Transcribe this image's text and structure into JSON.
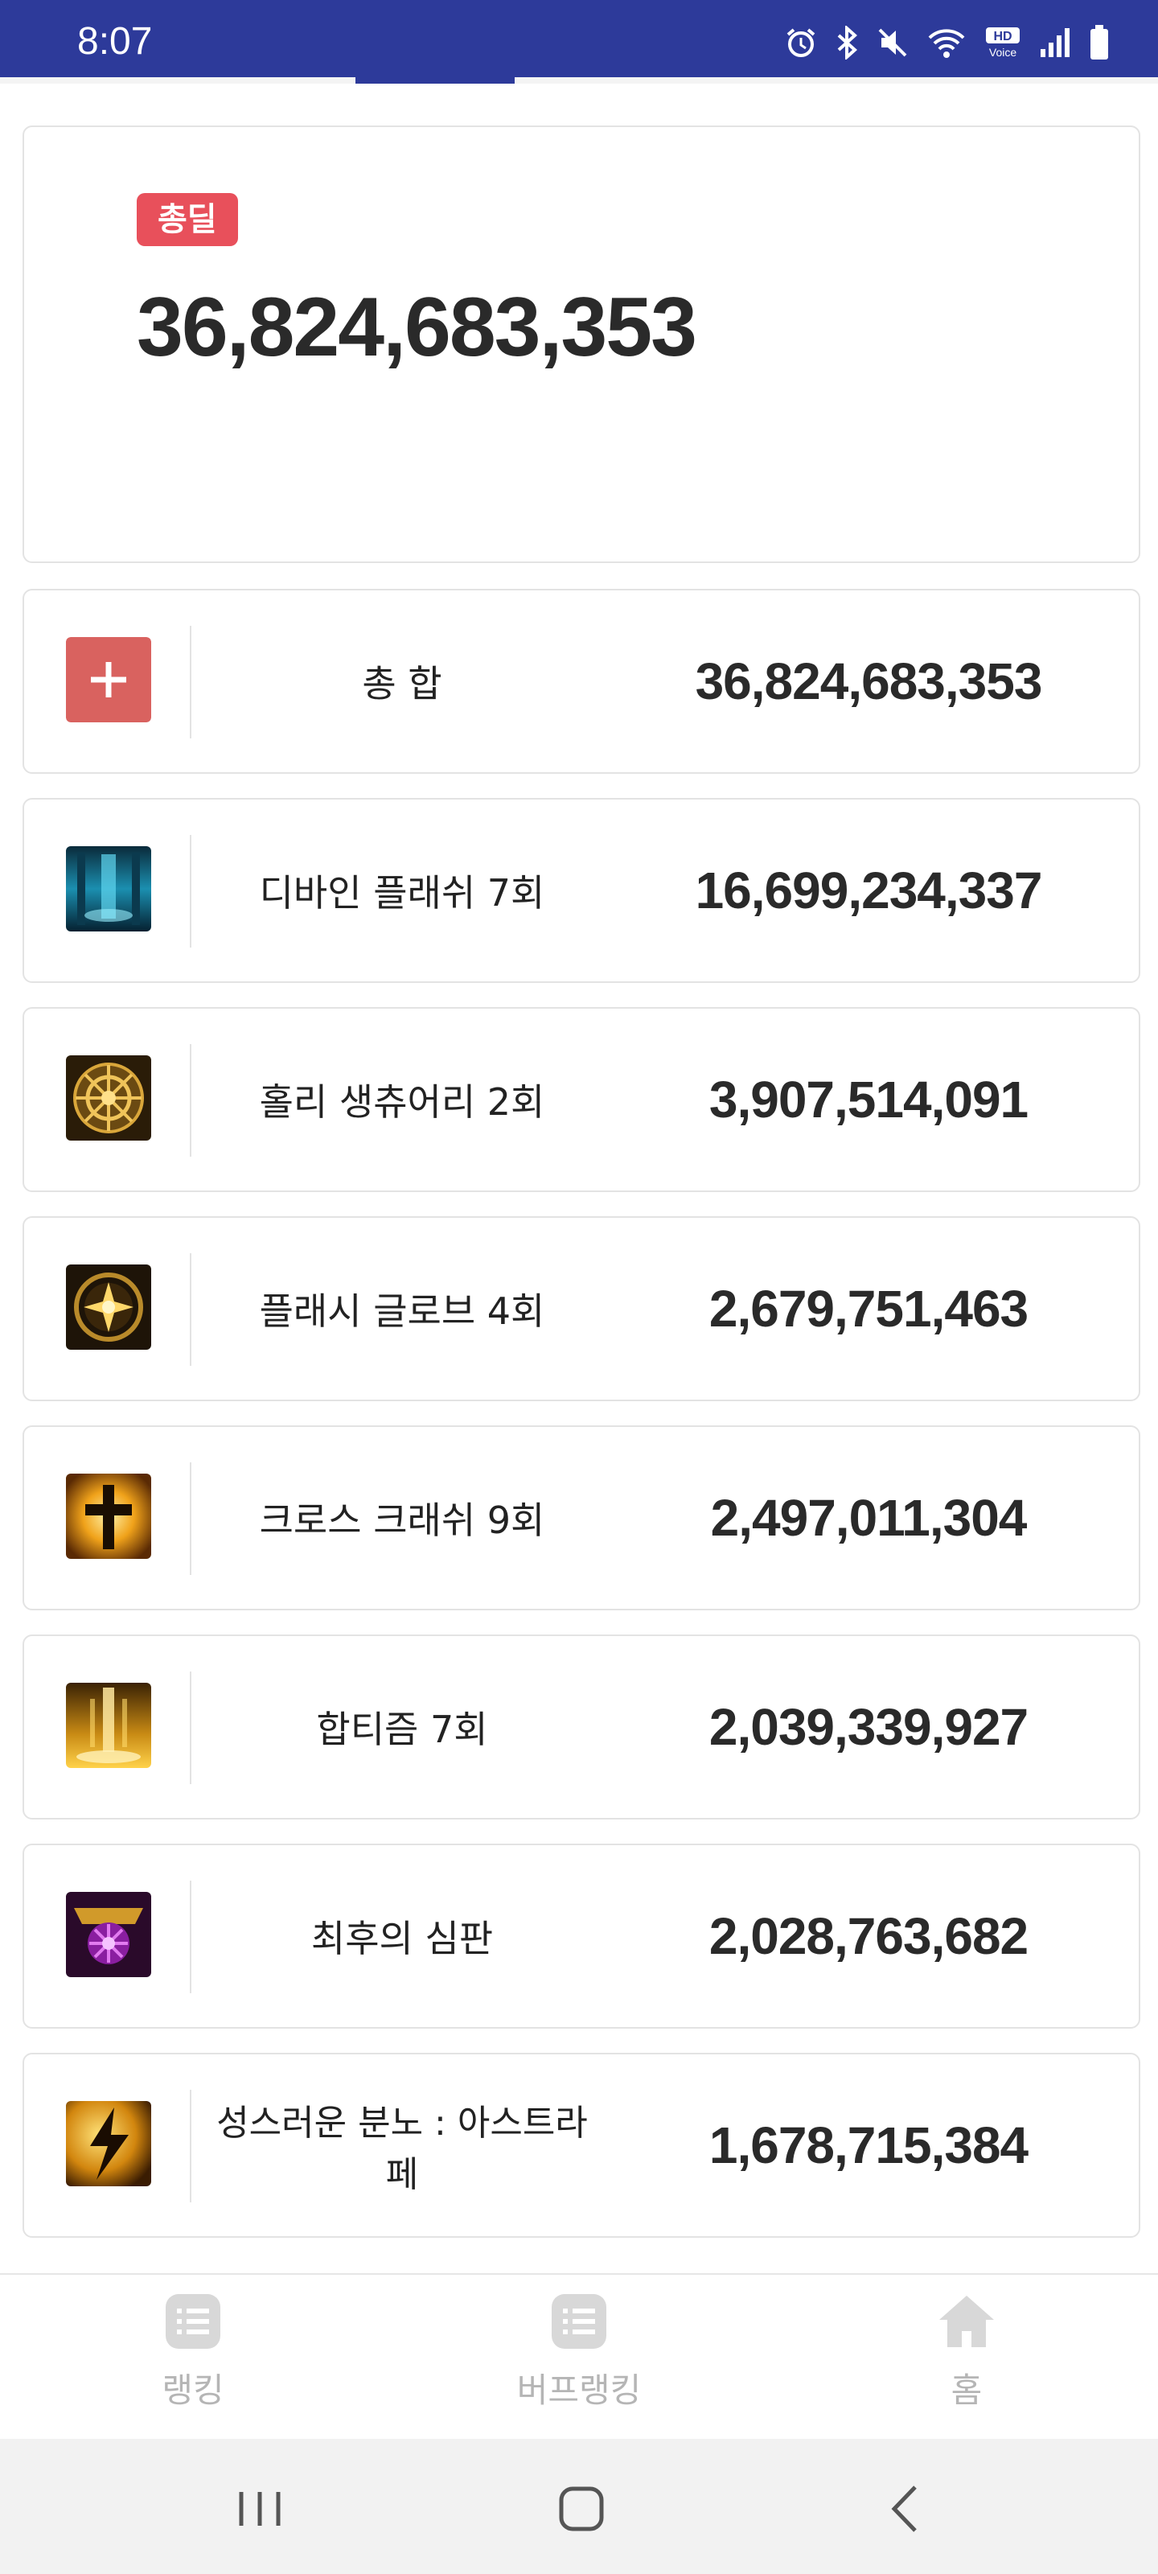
{
  "status_bar": {
    "time": "8:07"
  },
  "total": {
    "badge": "총딜",
    "value": "36,824,683,353"
  },
  "rows": [
    {
      "name": "총 합",
      "value": "36,824,683,353",
      "icon": "plus-icon"
    },
    {
      "name": "디바인 플래쉬 7회",
      "value": "16,699,234,337",
      "icon": "divine-flash-skill-icon"
    },
    {
      "name": "홀리 생츄어리 2회",
      "value": "3,907,514,091",
      "icon": "holy-sanctuary-skill-icon"
    },
    {
      "name": "플래시 글로브 4회",
      "value": "2,679,751,463",
      "icon": "flash-globe-skill-icon"
    },
    {
      "name": "크로스 크래쉬 9회",
      "value": "2,497,011,304",
      "icon": "cross-crash-skill-icon"
    },
    {
      "name": "합티즘 7회",
      "value": "2,039,339,927",
      "icon": "baptism-skill-icon"
    },
    {
      "name": "최후의 심판",
      "value": "2,028,763,682",
      "icon": "last-judgment-skill-icon"
    },
    {
      "name": "성스러운 분노 : 아스트라페",
      "value": "1,678,715,384",
      "icon": "holy-wrath-astrape-skill-icon"
    }
  ],
  "bottom_nav": [
    {
      "label": "랭킹",
      "icon": "list-icon"
    },
    {
      "label": "버프랭킹",
      "icon": "list-icon"
    },
    {
      "label": "홈",
      "icon": "home-icon"
    }
  ],
  "colors": {
    "status_bar": "#2d3a9a",
    "badge": "#e8505b",
    "plus": "#d9625f",
    "nav_inactive": "#b5b5b5"
  }
}
